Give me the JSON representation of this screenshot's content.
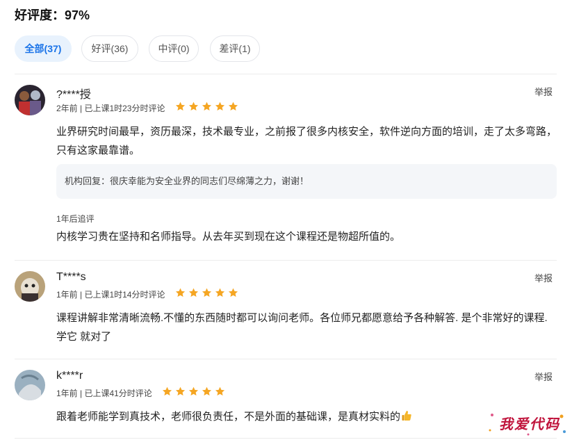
{
  "rating": {
    "label": "好评度：",
    "value": "97%"
  },
  "tabs": [
    {
      "label": "全部(37)",
      "active": true
    },
    {
      "label": "好评(36)",
      "active": false
    },
    {
      "label": "中评(0)",
      "active": false
    },
    {
      "label": "差评(1)",
      "active": false
    }
  ],
  "reviews": [
    {
      "user": "?****授",
      "meta": "2年前 | 已上课1时23分时评论",
      "stars": 5,
      "report": "举报",
      "content": "业界研究时间最早，资历最深，技术最专业，之前报了很多内核安全，软件逆向方面的培训，走了太多弯路，只有这家最靠谱。",
      "reply": "机构回复：很庆幸能为安全业界的同志们尽绵薄之力，谢谢！",
      "followup_label": "1年后追评",
      "followup": "内核学习贵在坚持和名师指导。从去年买到现在这个课程还是物超所值的。"
    },
    {
      "user": "T****s",
      "meta": "1年前 | 已上课1时14分时评论",
      "stars": 5,
      "report": "举报",
      "content": "课程讲解非常清晰流畅.不懂的东西随时都可以询问老师。各位师兄都愿意给予各种解答. 是个非常好的课程. 学它 就对了"
    },
    {
      "user": "k****r",
      "meta": "1年前 | 已上课41分时评论",
      "stars": 5,
      "report": "举报",
      "content": "跟着老师能学到真技术，老师很负责任，不是外面的基础课，是真材实料的"
    }
  ],
  "watermark": "我爱代码",
  "colors": {
    "accent": "#1a73e8",
    "star": "#f5a623",
    "tab_active_bg": "#e8f2fd"
  },
  "icons": {
    "star": "star-icon",
    "thumbs_up": "thumbs-up-icon"
  }
}
